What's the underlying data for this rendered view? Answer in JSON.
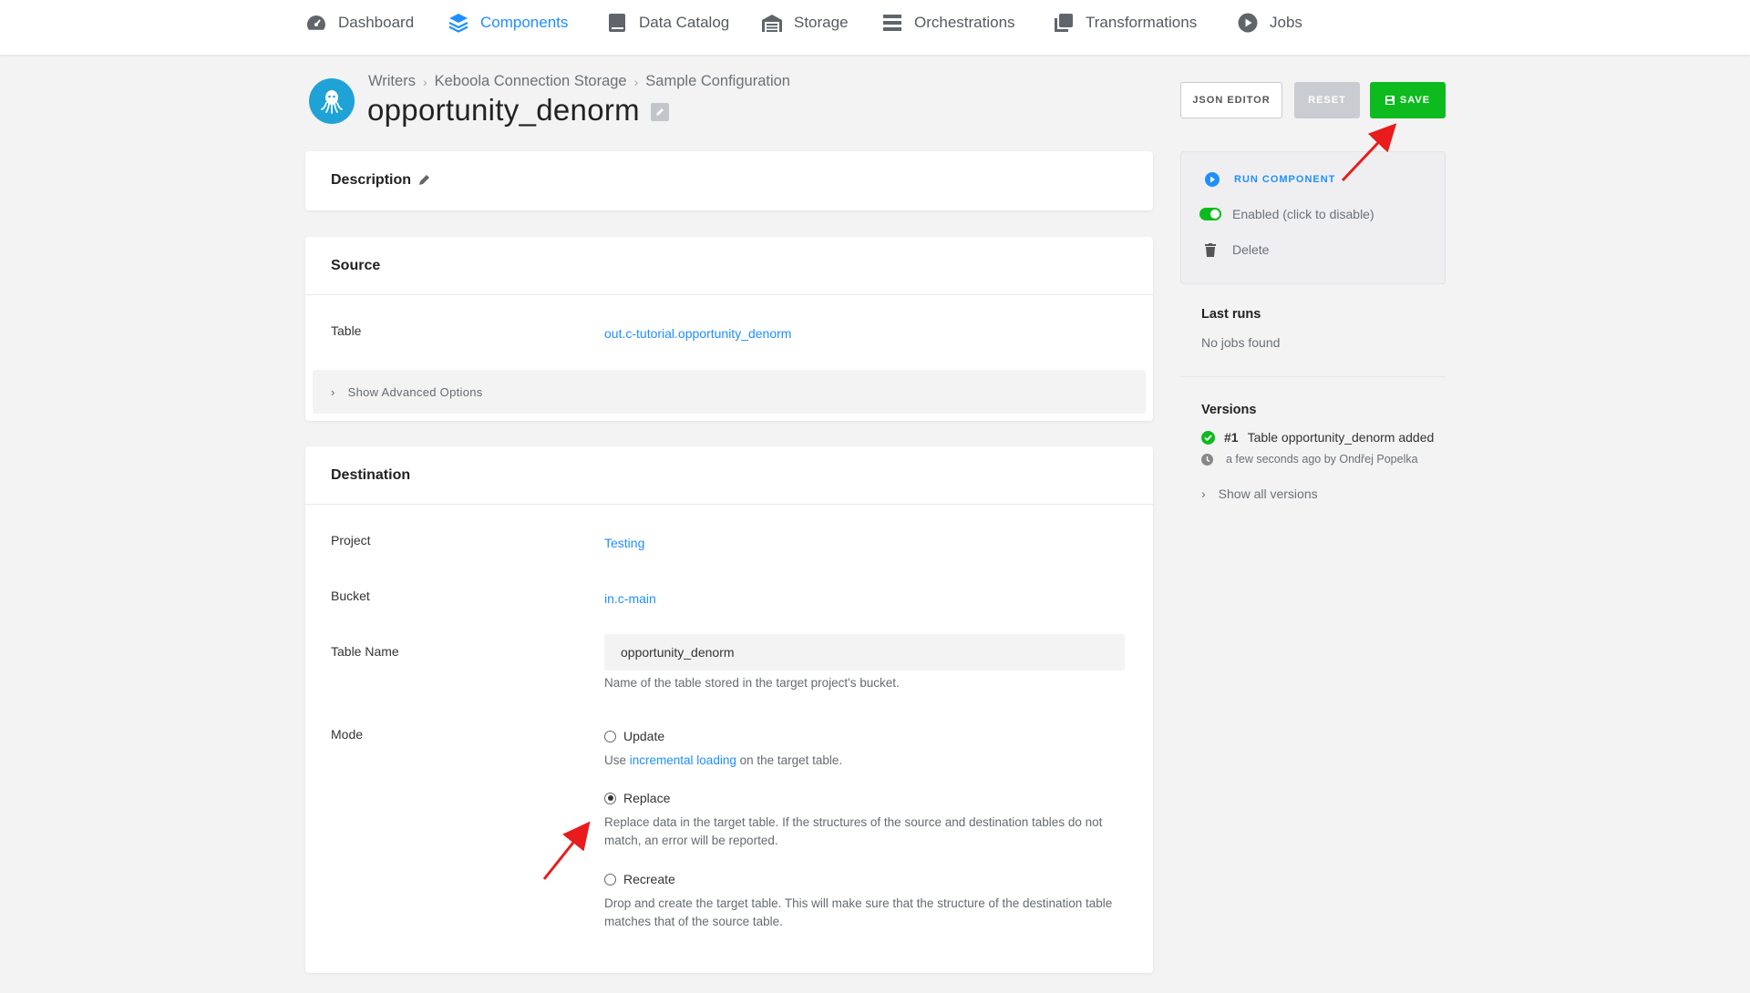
{
  "nav": {
    "items": [
      {
        "label": "Dashboard",
        "icon": "gauge-icon"
      },
      {
        "label": "Components",
        "icon": "layers-icon"
      },
      {
        "label": "Data Catalog",
        "icon": "book-icon"
      },
      {
        "label": "Storage",
        "icon": "warehouse-icon"
      },
      {
        "label": "Orchestrations",
        "icon": "bars-icon"
      },
      {
        "label": "Transformations",
        "icon": "copy-icon"
      },
      {
        "label": "Jobs",
        "icon": "play-circle-icon"
      }
    ],
    "active": "Components",
    "active_color": "#1f8fff"
  },
  "breadcrumb": [
    "Writers",
    "Keboola Connection Storage",
    "Sample Configuration"
  ],
  "title": "opportunity_denorm",
  "toolbar": {
    "json_editor_label": "JSON EDITOR",
    "reset_label": "RESET",
    "save_label": "SAVE",
    "save_color": "#0dbb1e"
  },
  "description": {
    "label": "Description"
  },
  "source": {
    "heading": "Source",
    "table_label": "Table",
    "table_value": "out.c-tutorial.opportunity_denorm",
    "advanced_label": "Show Advanced Options"
  },
  "destination": {
    "heading": "Destination",
    "project_label": "Project",
    "project_value": "Testing",
    "bucket_label": "Bucket",
    "bucket_value": "in.c-main",
    "table_name_label": "Table Name",
    "table_name_value": "opportunity_denorm",
    "table_name_help": "Name of the table stored in the target project's bucket.",
    "mode_label": "Mode",
    "modes": [
      {
        "label": "Update",
        "help_pre": "Use ",
        "help_link": "incremental loading",
        "help_post": " on the target table.",
        "selected": false
      },
      {
        "label": "Replace",
        "help": "Replace data in the target table. If the structures of the source and destination tables do not match, an error will be reported.",
        "selected": true
      },
      {
        "label": "Recreate",
        "help": "Drop and create the target table. This will make sure that the structure of the destination table matches that of the source table.",
        "selected": false
      }
    ]
  },
  "sidebar": {
    "run_label": "RUN COMPONENT",
    "enabled_label": "Enabled (click to disable)",
    "delete_label": "Delete",
    "last_runs_heading": "Last runs",
    "last_runs_empty": "No jobs found",
    "versions_heading": "Versions",
    "version": {
      "number": "#1",
      "text": "Table opportunity_denorm added",
      "meta": "a few seconds ago by Ondřej Popelka"
    },
    "show_all_versions": "Show all versions"
  }
}
